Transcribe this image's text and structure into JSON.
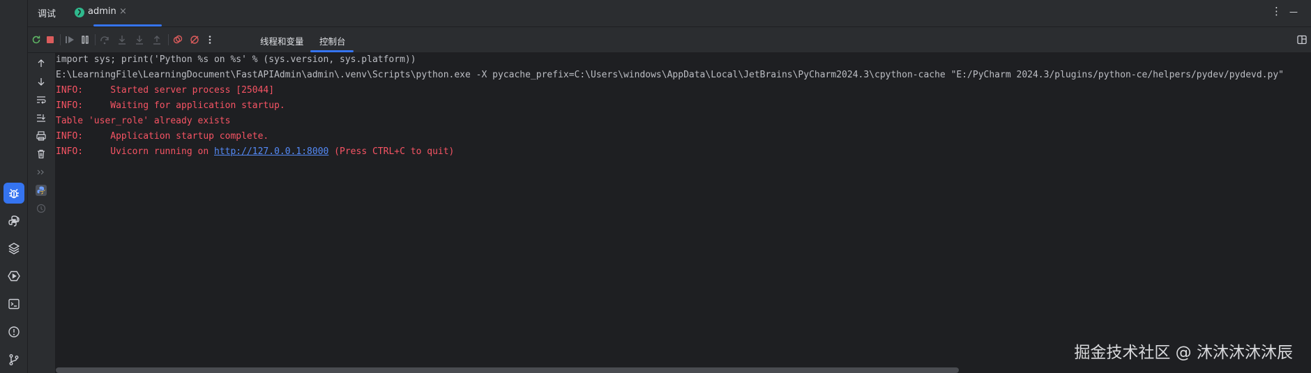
{
  "header": {
    "debug_label": "调试",
    "run_tab_label": "admin",
    "close_glyph": "×",
    "more_glyph": "⋮",
    "minimize_glyph": "—"
  },
  "toolbar": {
    "tab_threads": "线程和变量",
    "tab_console": "控制台"
  },
  "console": {
    "lines": [
      {
        "text": "import sys; print('Python %s on %s' % (sys.version, sys.platform))"
      },
      {
        "text": "E:\\LearningFile\\LearningDocument\\FastAPIAdmin\\admin\\.venv\\Scripts\\python.exe -X pycache_prefix=C:\\Users\\windows\\AppData\\Local\\JetBrains\\PyCharm2024.3\\cpython-cache \"E:/PyCharm 2024.3/plugins/python-ce/helpers/pydev/pydevd.py\""
      },
      {
        "text": "INFO:     Started server process [25044]"
      },
      {
        "text": "INFO:     Waiting for application startup."
      },
      {
        "text": "Table 'user_role' already exists"
      },
      {
        "text": "INFO:     Application startup complete."
      },
      {
        "prefix": "INFO:     Uvicorn running on ",
        "link": "http://127.0.0.1:8000",
        "suffix": " (Press CTRL+C to quit)"
      }
    ]
  },
  "watermark": "掘金技术社区 @ 沐沐沐沐沐辰",
  "colors": {
    "accent": "#3574f0",
    "error_text": "#f75464",
    "link": "#548af7",
    "stop_red": "#db5c5c",
    "resume_green": "#5fb865"
  }
}
